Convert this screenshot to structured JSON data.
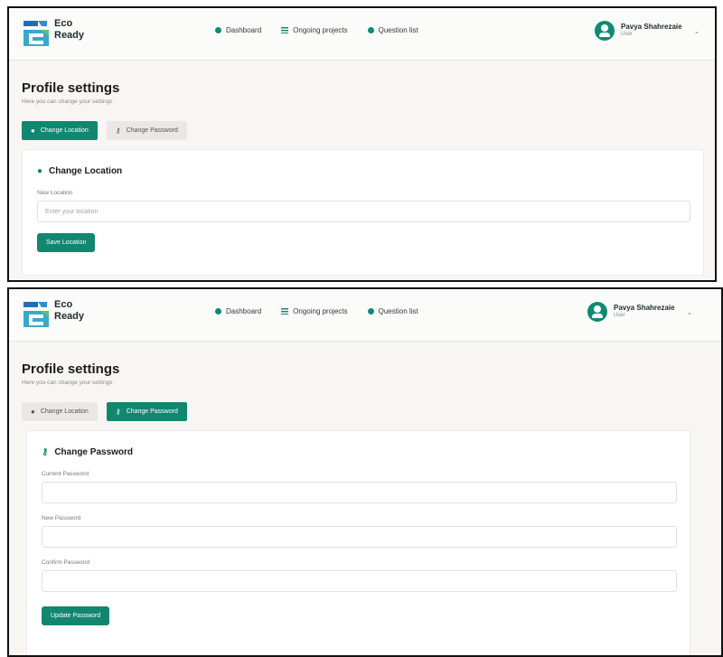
{
  "app": {
    "logo_line1": "Eco",
    "logo_line2": "Ready"
  },
  "nav": [
    {
      "label": "Dashboard",
      "icon": "dashboard-dot-icon"
    },
    {
      "label": "Ongoing projects",
      "icon": "list-icon"
    },
    {
      "label": "Question list",
      "icon": "question-dot-icon"
    }
  ],
  "user": {
    "name": "Pavya Shahrezaie",
    "role": "User",
    "caret": "⌄"
  },
  "page": {
    "title": "Profile settings",
    "subtitle": "Here you can change your settings"
  },
  "tabs": {
    "location": "Change Location",
    "password": "Change Password"
  },
  "location_card": {
    "title": "Change Location",
    "field_label": "New Location",
    "placeholder": "Enter your location",
    "button": "Save Location"
  },
  "password_card": {
    "title": "Change Password",
    "current_label": "Current Password",
    "new_label": "New Password",
    "confirm_label": "Confirm Password",
    "button": "Update Password"
  },
  "colors": {
    "accent": "#12876f",
    "background": "#f7f6f3",
    "card": "#ffffff"
  }
}
